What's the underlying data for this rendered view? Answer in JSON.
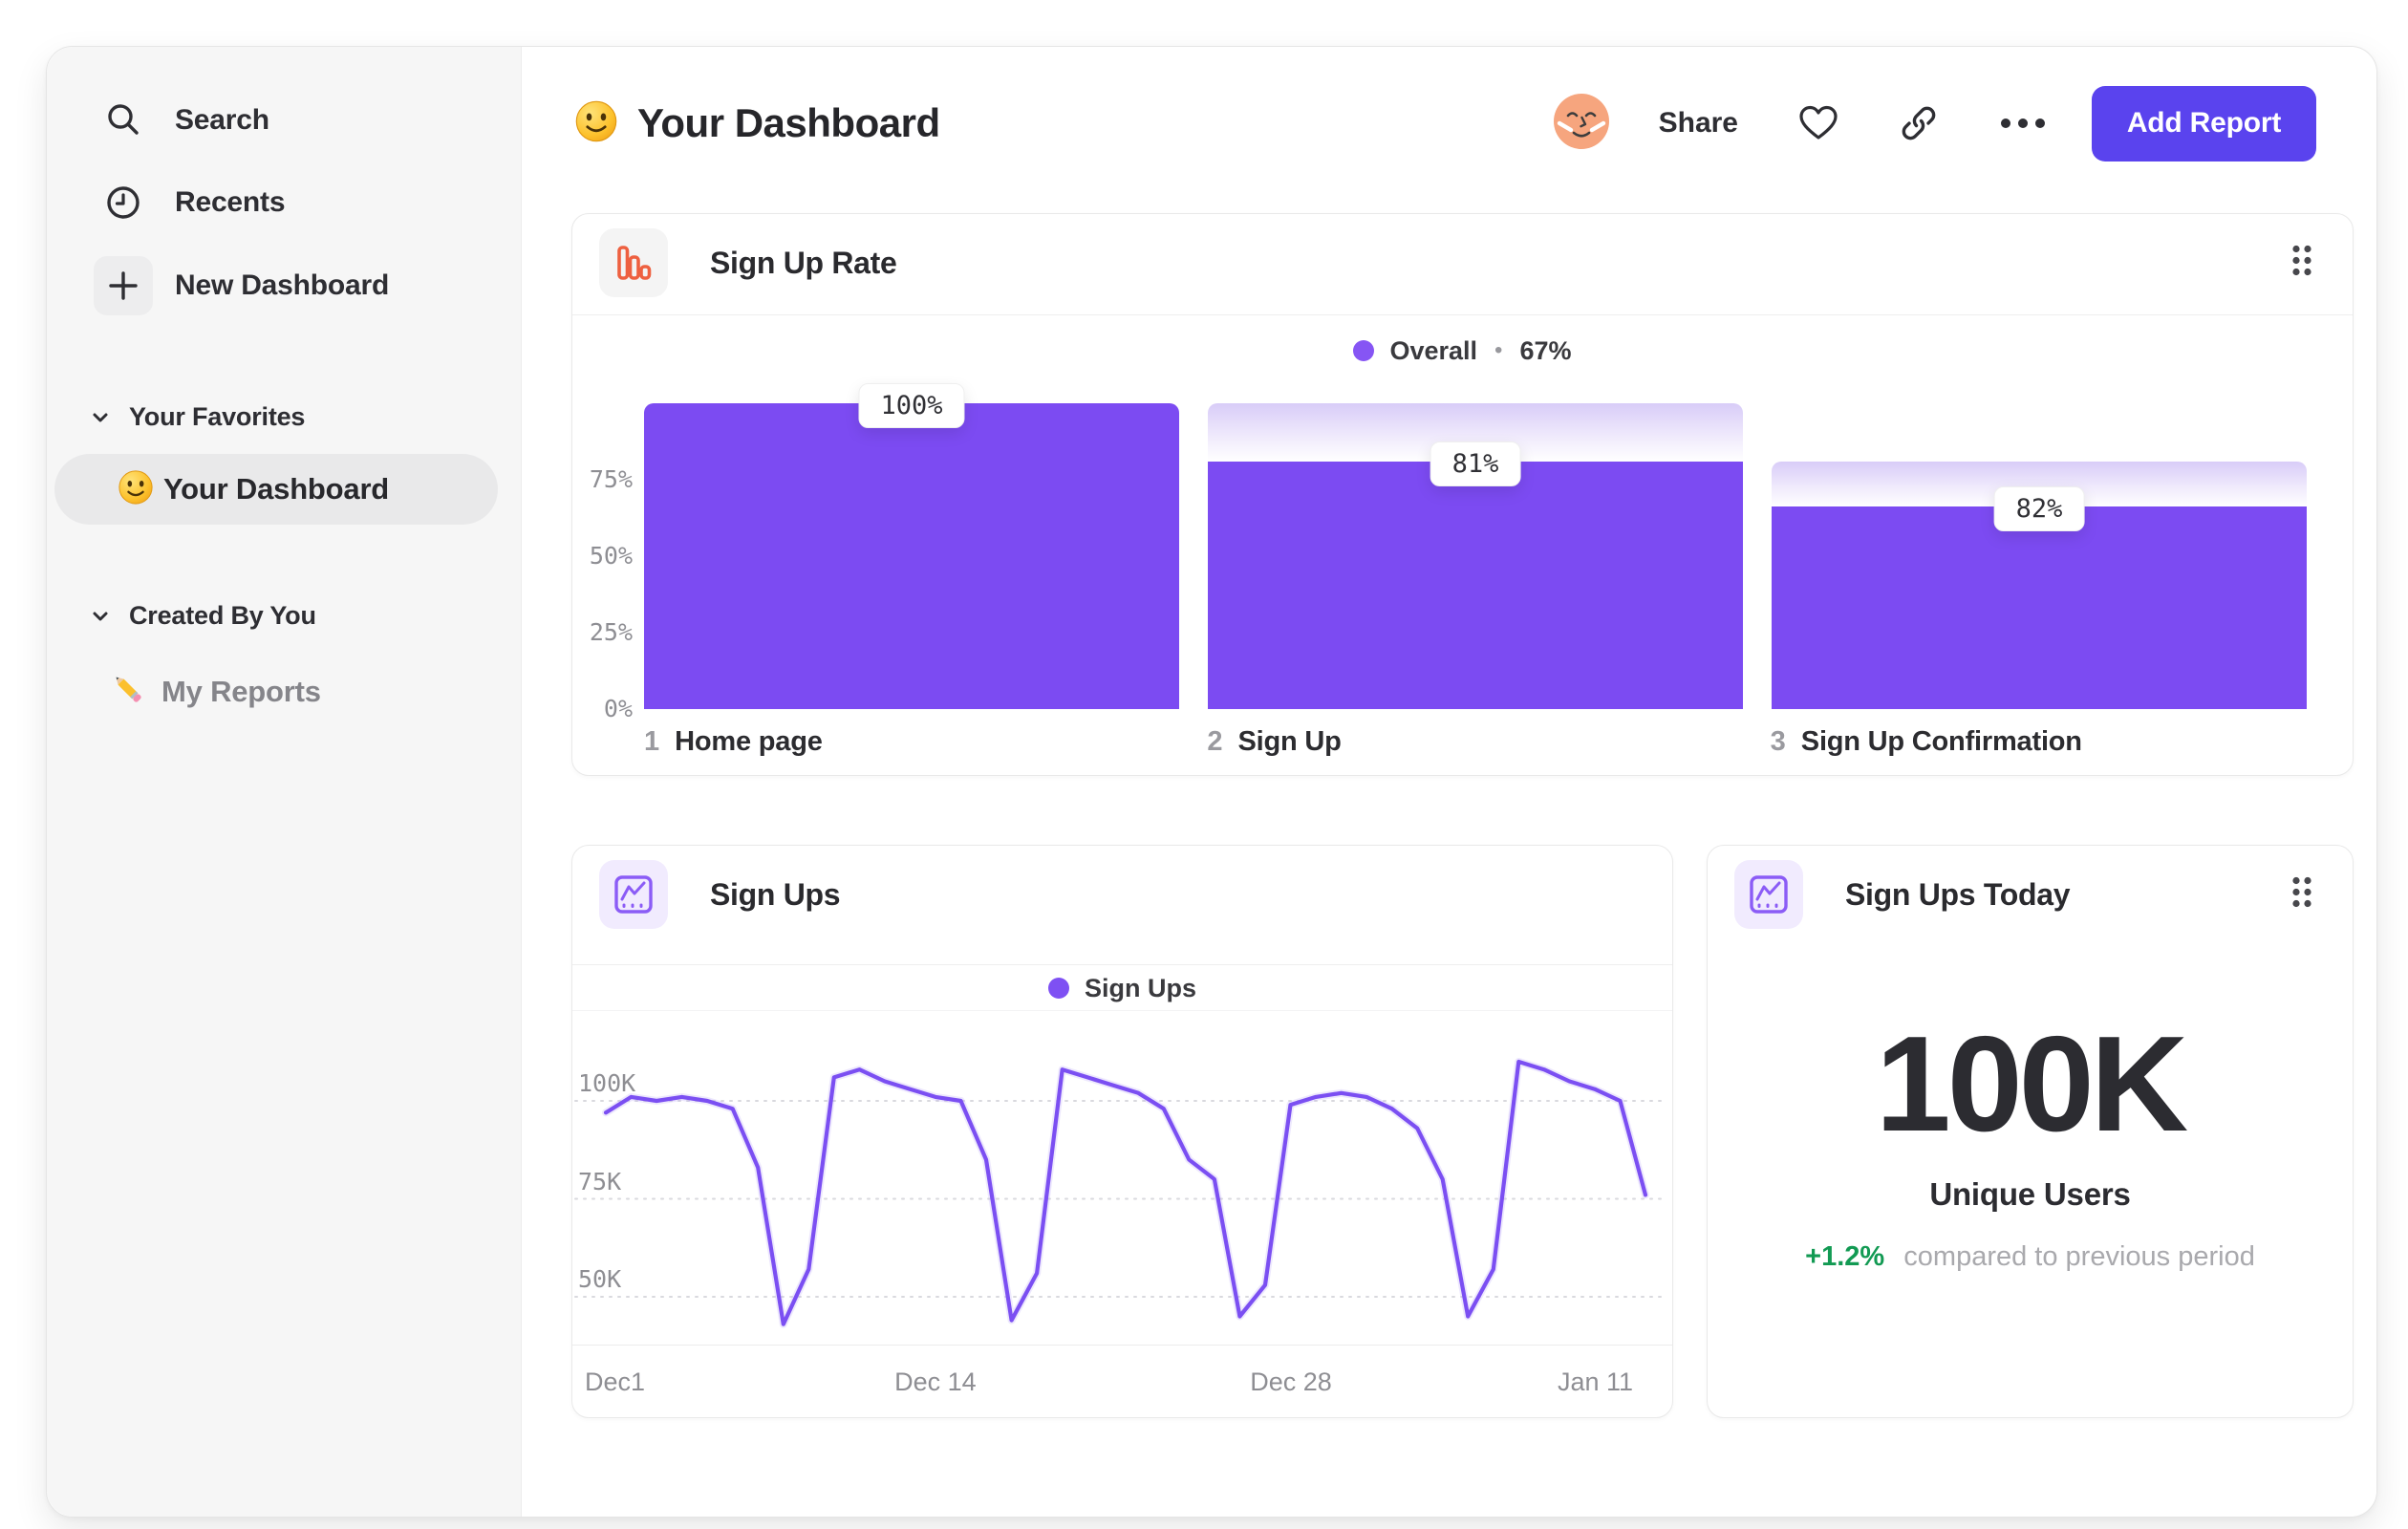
{
  "sidebar": {
    "items": [
      {
        "label": "Search",
        "icon": "search-icon"
      },
      {
        "label": "Recents",
        "icon": "clock-icon"
      },
      {
        "label": "New Dashboard",
        "icon": "plus-icon"
      }
    ],
    "sections": [
      {
        "title": "Your Favorites",
        "items": [
          {
            "label": "Your Dashboard",
            "icon": "smiley-emoji",
            "selected": true
          }
        ]
      },
      {
        "title": "Created By You",
        "items": [
          {
            "label": "My Reports",
            "icon": "pencil-emoji",
            "selected": false
          }
        ]
      }
    ]
  },
  "header": {
    "title": "Your Dashboard",
    "title_icon": "smiley-emoji",
    "avatar": "user-avatar",
    "share_label": "Share",
    "icons": [
      "heart-icon",
      "link-icon",
      "more-icon"
    ],
    "add_report_label": "Add Report"
  },
  "cards": {
    "sign_up_rate": {
      "title": "Sign Up Rate",
      "icon": "bar-chart-icon",
      "legend": {
        "series": "Overall",
        "separator": "•",
        "value": "67%"
      },
      "chart_data": {
        "type": "bar",
        "subtype": "funnel",
        "title": "Sign Up Rate",
        "categories": [
          "Home page",
          "Sign Up",
          "Sign Up Confirmation"
        ],
        "step_numbers": [
          "1",
          "2",
          "3"
        ],
        "conversion_labels": [
          "100%",
          "81%",
          "82%"
        ],
        "overall_pct": [
          100,
          81,
          66.4
        ],
        "prev_pct": [
          null,
          100,
          81
        ],
        "yticks": [
          "75%",
          "50%",
          "25%",
          "0%"
        ],
        "ytick_values": [
          75,
          50,
          25,
          0
        ],
        "ylim": [
          0,
          100
        ],
        "series_name": "Overall",
        "overall_value": "67%",
        "bar_color": "#7c4bf2"
      }
    },
    "sign_ups": {
      "title": "Sign Ups",
      "icon": "line-chart-icon",
      "legend": {
        "series": "Sign Ups"
      },
      "chart_data": {
        "type": "line",
        "title": "Sign Ups",
        "series_name": "Sign Ups",
        "x_labels": [
          "Dec1",
          "Dec 14",
          "Dec 28",
          "Jan 11"
        ],
        "x_label_fracs": [
          0,
          0.317,
          0.659,
          1
        ],
        "yticks": [
          {
            "label": "100K",
            "value": 100
          },
          {
            "label": "75K",
            "value": 75
          },
          {
            "label": "50K",
            "value": 50
          }
        ],
        "unit": "K",
        "values": [
          97,
          101,
          100,
          101,
          100,
          98,
          83,
          43,
          57,
          106,
          108,
          105,
          103,
          101,
          100,
          85,
          44,
          56,
          108,
          106,
          104,
          102,
          98,
          85,
          80,
          45,
          53,
          99,
          101,
          102,
          101,
          98,
          93,
          80,
          45,
          57,
          110,
          108,
          105,
          103,
          100,
          76
        ],
        "ylim": [
          30,
          115
        ],
        "grid": "dotted-horizontal",
        "line_color": "#7b4ff2"
      }
    },
    "sign_ups_today": {
      "title": "Sign Ups Today",
      "icon": "line-chart-icon",
      "value": "100K",
      "label": "Unique Users",
      "change": "+1.2%",
      "change_note": "compared to previous period"
    }
  },
  "colors": {
    "accent_purple": "#7c4bf2",
    "button_purple": "#5a43ee",
    "icon_orange": "#ee6040",
    "positive_green": "#129a53",
    "sidebar_bg": "#f6f6f6",
    "text_dark": "#2c2c31",
    "text_gray": "#8e8e93"
  }
}
